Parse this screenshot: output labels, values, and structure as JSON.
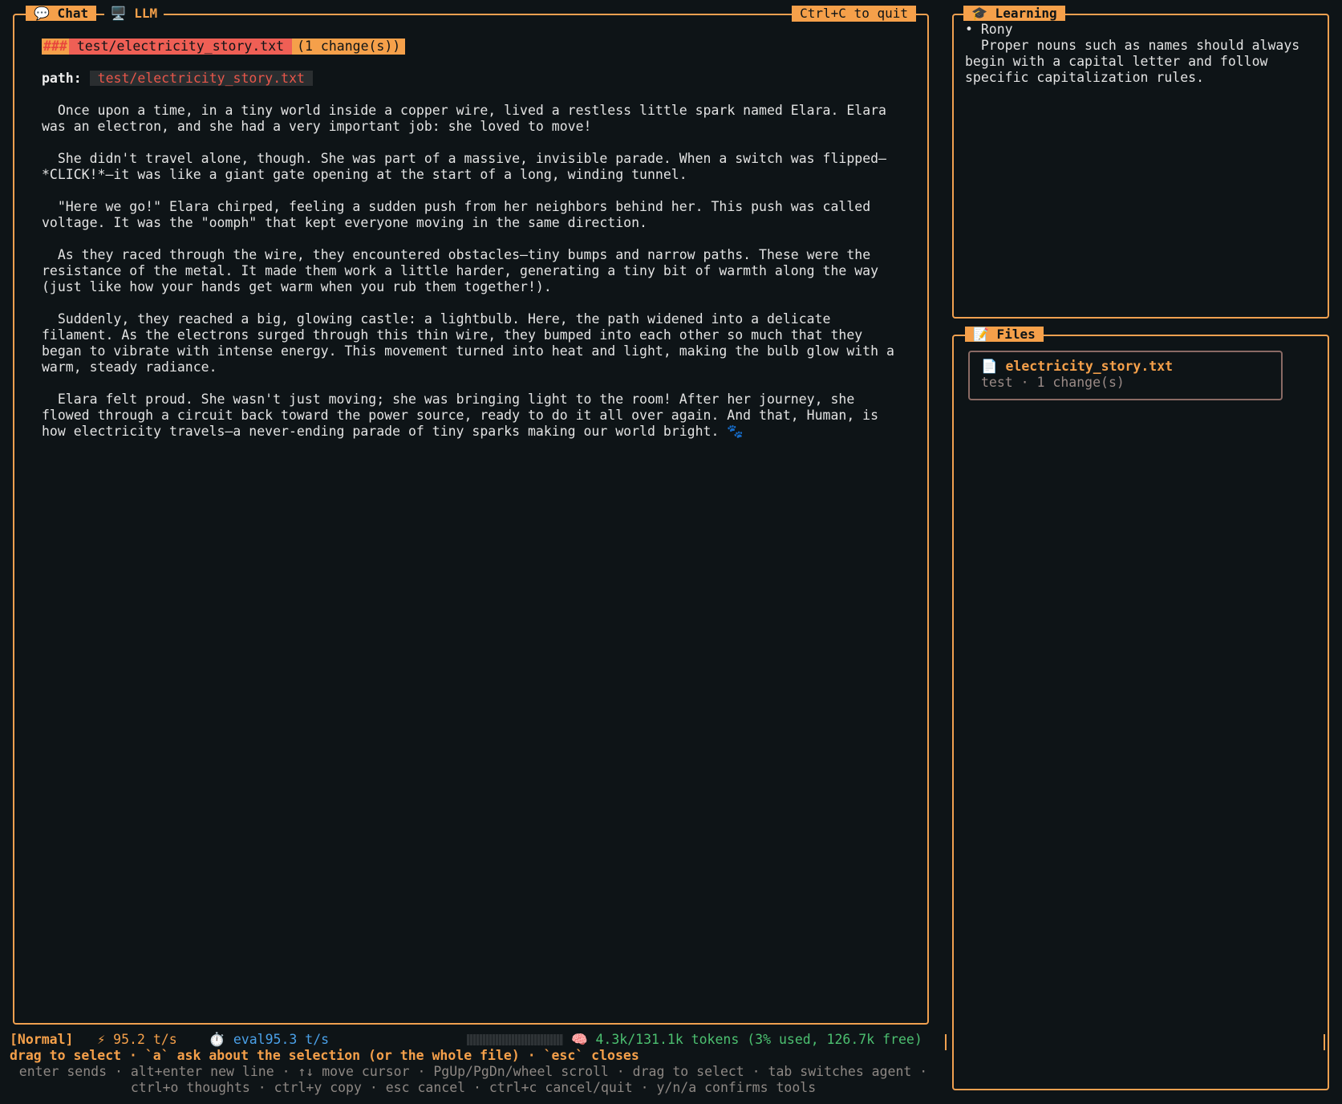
{
  "chat_panel": {
    "tab_chat": "💬 Chat",
    "tab_llm": "🖥️ LLM",
    "quit_hint": "Ctrl+C to quit",
    "file_header": {
      "hashes": "###",
      "filename": "test/electricity_story.txt",
      "changes": "(1 change(s))"
    },
    "path_label": "path:",
    "path_value": "test/electricity_story.txt",
    "paragraphs": [
      "  Once upon a time, in a tiny world inside a copper wire, lived a restless little spark named Elara. Elara was an electron, and she had a very important job: she loved to move!",
      "  She didn't travel alone, though. She was part of a massive, invisible parade. When a switch was flipped—*CLICK!*—it was like a giant gate opening at the start of a long, winding tunnel.",
      "  \"Here we go!\" Elara chirped, feeling a sudden push from her neighbors behind her. This push was called voltage. It was the \"oomph\" that kept everyone moving in the same direction.",
      "  As they raced through the wire, they encountered obstacles—tiny bumps and narrow paths. These were the resistance of the metal. It made them work a little harder, generating a tiny bit of warmth along the way (just like how your hands get warm when you rub them together!).",
      "  Suddenly, they reached a big, glowing castle: a lightbulb. Here, the path widened into a delicate filament. As the electrons surged through this thin wire, they bumped into each other so much that they began to vibrate with intense energy. This movement turned into heat and light, making the bulb glow with a warm, steady radiance.",
      "  Elara felt proud. She wasn't just moving; she was bringing light to the room! After her journey, she flowed through a circuit back toward the power source, ready to do it all over again. And that, Human, is how electricity travels—a never-ending parade of tiny sparks making our world bright. 🐾"
    ]
  },
  "learning_panel": {
    "title": "🎓 Learning",
    "bullet": "• Rony",
    "text": "  Proper nouns such as names should always begin with a capital letter and follow specific capitalization rules."
  },
  "files_panel": {
    "title": "📝 Files",
    "file": {
      "name": "📄 electricity_story.txt",
      "meta": "test · 1 change(s)"
    }
  },
  "status": {
    "mode": "[Normal]",
    "speed": "⚡ 95.2 t/s",
    "eval": "⏱️ eval95.3  t/s",
    "tokens": "🧠 4.3k/131.1k tokens (3% used, 126.7k free)"
  },
  "hint": "drag to select · `a` ask about the selection (or the whole file) · `esc` closes",
  "help": [
    "enter sends · alt+enter new line · ↑↓ move cursor · PgUp/PgDn/wheel scroll · drag to select · tab switches agent ·",
    "ctrl+o thoughts · ctrl+y copy · esc cancel · ctrl+c cancel/quit · y/n/a confirms tools"
  ],
  "colors": {
    "accent": "#f5a04a",
    "background": "#0e1417",
    "filename_red": "#ef5f55",
    "token_green": "#4cc070",
    "eval_blue": "#4aa0e8"
  }
}
